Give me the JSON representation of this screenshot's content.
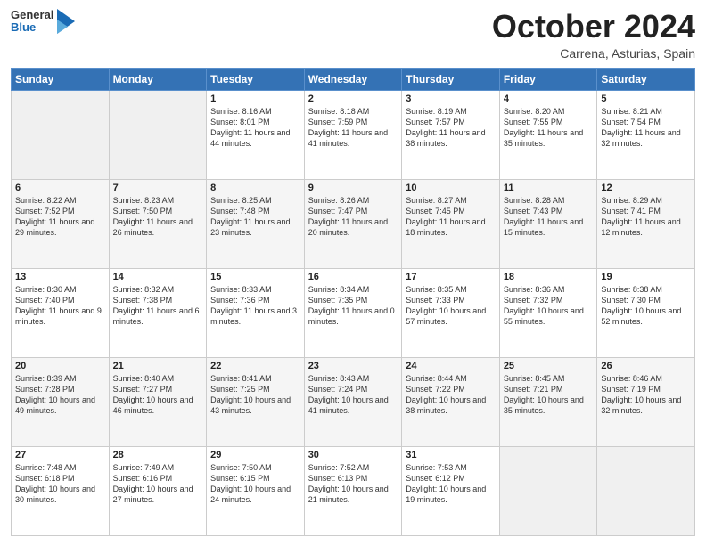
{
  "header": {
    "logo_general": "General",
    "logo_blue": "Blue",
    "month_title": "October 2024",
    "location": "Carrena, Asturias, Spain"
  },
  "days_of_week": [
    "Sunday",
    "Monday",
    "Tuesday",
    "Wednesday",
    "Thursday",
    "Friday",
    "Saturday"
  ],
  "weeks": [
    [
      {
        "day": "",
        "content": ""
      },
      {
        "day": "",
        "content": ""
      },
      {
        "day": "1",
        "content": "Sunrise: 8:16 AM\nSunset: 8:01 PM\nDaylight: 11 hours and 44 minutes."
      },
      {
        "day": "2",
        "content": "Sunrise: 8:18 AM\nSunset: 7:59 PM\nDaylight: 11 hours and 41 minutes."
      },
      {
        "day": "3",
        "content": "Sunrise: 8:19 AM\nSunset: 7:57 PM\nDaylight: 11 hours and 38 minutes."
      },
      {
        "day": "4",
        "content": "Sunrise: 8:20 AM\nSunset: 7:55 PM\nDaylight: 11 hours and 35 minutes."
      },
      {
        "day": "5",
        "content": "Sunrise: 8:21 AM\nSunset: 7:54 PM\nDaylight: 11 hours and 32 minutes."
      }
    ],
    [
      {
        "day": "6",
        "content": "Sunrise: 8:22 AM\nSunset: 7:52 PM\nDaylight: 11 hours and 29 minutes."
      },
      {
        "day": "7",
        "content": "Sunrise: 8:23 AM\nSunset: 7:50 PM\nDaylight: 11 hours and 26 minutes."
      },
      {
        "day": "8",
        "content": "Sunrise: 8:25 AM\nSunset: 7:48 PM\nDaylight: 11 hours and 23 minutes."
      },
      {
        "day": "9",
        "content": "Sunrise: 8:26 AM\nSunset: 7:47 PM\nDaylight: 11 hours and 20 minutes."
      },
      {
        "day": "10",
        "content": "Sunrise: 8:27 AM\nSunset: 7:45 PM\nDaylight: 11 hours and 18 minutes."
      },
      {
        "day": "11",
        "content": "Sunrise: 8:28 AM\nSunset: 7:43 PM\nDaylight: 11 hours and 15 minutes."
      },
      {
        "day": "12",
        "content": "Sunrise: 8:29 AM\nSunset: 7:41 PM\nDaylight: 11 hours and 12 minutes."
      }
    ],
    [
      {
        "day": "13",
        "content": "Sunrise: 8:30 AM\nSunset: 7:40 PM\nDaylight: 11 hours and 9 minutes."
      },
      {
        "day": "14",
        "content": "Sunrise: 8:32 AM\nSunset: 7:38 PM\nDaylight: 11 hours and 6 minutes."
      },
      {
        "day": "15",
        "content": "Sunrise: 8:33 AM\nSunset: 7:36 PM\nDaylight: 11 hours and 3 minutes."
      },
      {
        "day": "16",
        "content": "Sunrise: 8:34 AM\nSunset: 7:35 PM\nDaylight: 11 hours and 0 minutes."
      },
      {
        "day": "17",
        "content": "Sunrise: 8:35 AM\nSunset: 7:33 PM\nDaylight: 10 hours and 57 minutes."
      },
      {
        "day": "18",
        "content": "Sunrise: 8:36 AM\nSunset: 7:32 PM\nDaylight: 10 hours and 55 minutes."
      },
      {
        "day": "19",
        "content": "Sunrise: 8:38 AM\nSunset: 7:30 PM\nDaylight: 10 hours and 52 minutes."
      }
    ],
    [
      {
        "day": "20",
        "content": "Sunrise: 8:39 AM\nSunset: 7:28 PM\nDaylight: 10 hours and 49 minutes."
      },
      {
        "day": "21",
        "content": "Sunrise: 8:40 AM\nSunset: 7:27 PM\nDaylight: 10 hours and 46 minutes."
      },
      {
        "day": "22",
        "content": "Sunrise: 8:41 AM\nSunset: 7:25 PM\nDaylight: 10 hours and 43 minutes."
      },
      {
        "day": "23",
        "content": "Sunrise: 8:43 AM\nSunset: 7:24 PM\nDaylight: 10 hours and 41 minutes."
      },
      {
        "day": "24",
        "content": "Sunrise: 8:44 AM\nSunset: 7:22 PM\nDaylight: 10 hours and 38 minutes."
      },
      {
        "day": "25",
        "content": "Sunrise: 8:45 AM\nSunset: 7:21 PM\nDaylight: 10 hours and 35 minutes."
      },
      {
        "day": "26",
        "content": "Sunrise: 8:46 AM\nSunset: 7:19 PM\nDaylight: 10 hours and 32 minutes."
      }
    ],
    [
      {
        "day": "27",
        "content": "Sunrise: 7:48 AM\nSunset: 6:18 PM\nDaylight: 10 hours and 30 minutes."
      },
      {
        "day": "28",
        "content": "Sunrise: 7:49 AM\nSunset: 6:16 PM\nDaylight: 10 hours and 27 minutes."
      },
      {
        "day": "29",
        "content": "Sunrise: 7:50 AM\nSunset: 6:15 PM\nDaylight: 10 hours and 24 minutes."
      },
      {
        "day": "30",
        "content": "Sunrise: 7:52 AM\nSunset: 6:13 PM\nDaylight: 10 hours and 21 minutes."
      },
      {
        "day": "31",
        "content": "Sunrise: 7:53 AM\nSunset: 6:12 PM\nDaylight: 10 hours and 19 minutes."
      },
      {
        "day": "",
        "content": ""
      },
      {
        "day": "",
        "content": ""
      }
    ]
  ]
}
